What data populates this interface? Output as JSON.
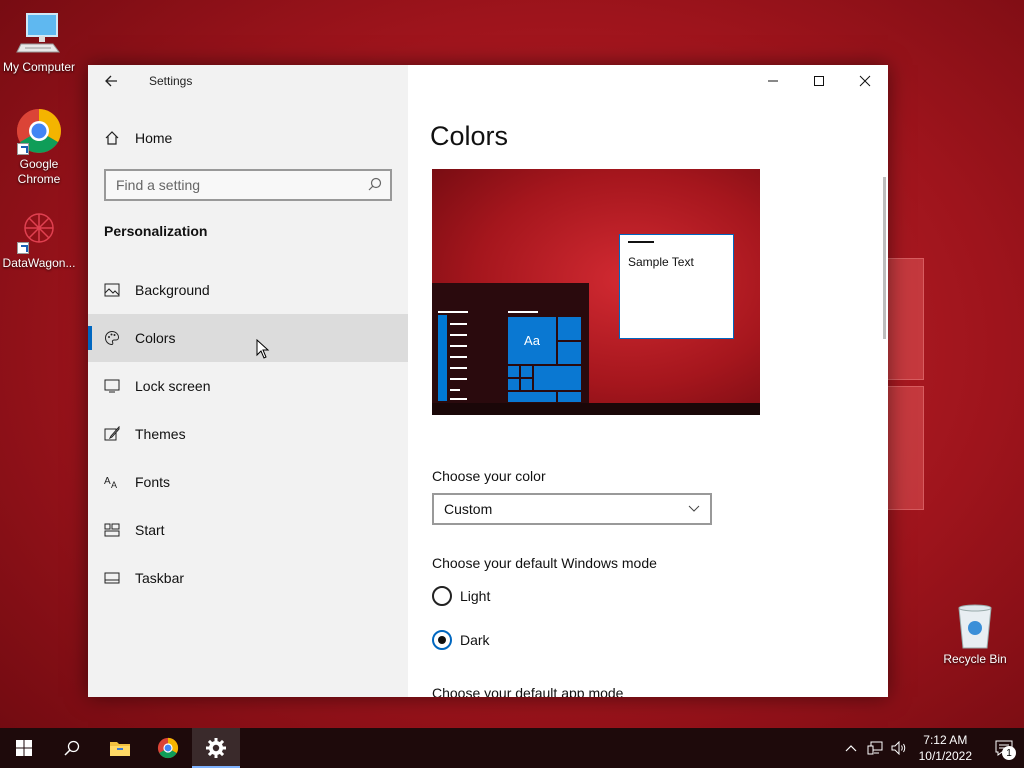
{
  "desktop": {
    "icons": [
      {
        "label": "My Computer"
      },
      {
        "label": "Google Chrome"
      },
      {
        "label": "DataWagon..."
      },
      {
        "label": "Recycle Bin"
      }
    ]
  },
  "window": {
    "app_title": "Settings",
    "home_label": "Home",
    "search_placeholder": "Find a setting",
    "section_heading": "Personalization",
    "nav_items": [
      {
        "label": "Background",
        "icon": "image-icon"
      },
      {
        "label": "Colors",
        "icon": "palette-icon",
        "active": true
      },
      {
        "label": "Lock screen",
        "icon": "monitor-icon"
      },
      {
        "label": "Themes",
        "icon": "brush-icon"
      },
      {
        "label": "Fonts",
        "icon": "fonts-icon"
      },
      {
        "label": "Start",
        "icon": "start-icon"
      },
      {
        "label": "Taskbar",
        "icon": "taskbar-icon"
      }
    ]
  },
  "content": {
    "page_title": "Colors",
    "preview": {
      "sample_text": "Sample Text",
      "tile_text": "Aa"
    },
    "choose_color_label": "Choose your color",
    "choose_color_value": "Custom",
    "windows_mode_label": "Choose your default Windows mode",
    "windows_mode_options": [
      {
        "label": "Light",
        "selected": false
      },
      {
        "label": "Dark",
        "selected": true
      }
    ],
    "app_mode_label": "Choose your default app mode"
  },
  "taskbar": {
    "time": "7:12 AM",
    "date": "10/1/2022",
    "notification_count": "1"
  },
  "colors": {
    "accent": "#0067c0",
    "desktop_red": "#b01c24",
    "sidebar_bg": "#f2f2f2"
  }
}
